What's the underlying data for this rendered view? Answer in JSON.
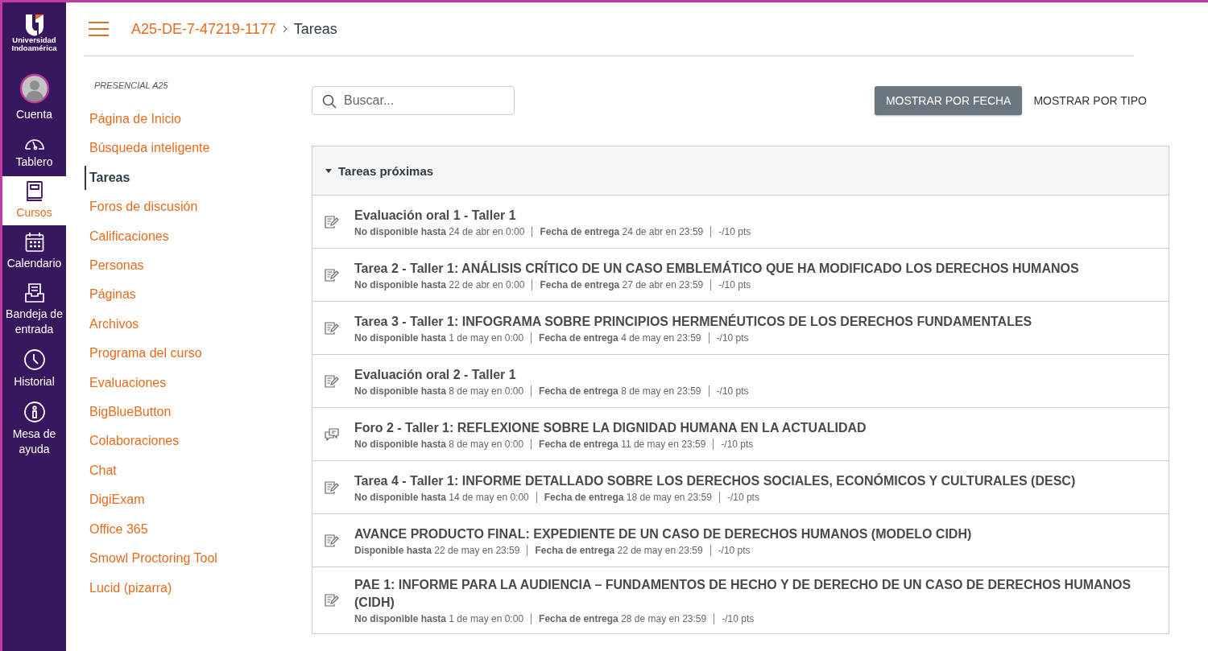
{
  "global_nav": {
    "logo_lines": [
      "Universidad",
      "Indoamérica"
    ],
    "items": [
      {
        "kind": "account",
        "label": "Cuenta",
        "selected": false
      },
      {
        "kind": "dashboard",
        "label": "Tablero",
        "selected": false
      },
      {
        "kind": "courses",
        "label": "Cursos",
        "selected": true
      },
      {
        "kind": "calendar",
        "label": "Calendario",
        "selected": false
      },
      {
        "kind": "inbox",
        "label": "Bandeja de entrada",
        "selected": false
      },
      {
        "kind": "history",
        "label": "Historial",
        "selected": false
      },
      {
        "kind": "help",
        "label": "Mesa de ayuda",
        "selected": false
      }
    ]
  },
  "breadcrumb": {
    "course": "A25-DE-7-47219-1177",
    "page": "Tareas"
  },
  "course_nav": {
    "section": "PRESENCIAL A25",
    "items": [
      {
        "label": "Página de Inicio",
        "selected": false
      },
      {
        "label": "Búsqueda inteligente",
        "selected": false
      },
      {
        "label": "Tareas",
        "selected": true
      },
      {
        "label": "Foros de discusión",
        "selected": false
      },
      {
        "label": "Calificaciones",
        "selected": false
      },
      {
        "label": "Personas",
        "selected": false
      },
      {
        "label": "Páginas",
        "selected": false
      },
      {
        "label": "Archivos",
        "selected": false
      },
      {
        "label": "Programa del curso",
        "selected": false
      },
      {
        "label": "Evaluaciones",
        "selected": false
      },
      {
        "label": "BigBlueButton",
        "selected": false
      },
      {
        "label": "Colaboraciones",
        "selected": false
      },
      {
        "label": "Chat",
        "selected": false
      },
      {
        "label": "DigiExam",
        "selected": false
      },
      {
        "label": "Office 365",
        "selected": false
      },
      {
        "label": "Smowl Proctoring Tool",
        "selected": false
      },
      {
        "label": "Lucid (pizarra)",
        "selected": false
      }
    ]
  },
  "search": {
    "placeholder": "Buscar..."
  },
  "view_buttons": [
    {
      "label": "MOSTRAR POR FECHA",
      "selected": true
    },
    {
      "label": "MOSTRAR POR TIPO",
      "selected": false
    }
  ],
  "group": {
    "title": "Tareas próximas",
    "expanded": true,
    "assignments": [
      {
        "kind": "assignment",
        "title": "Evaluación oral 1 - Taller 1",
        "availability": "**No disponible hasta** 24 de abr en 0:00",
        "due": "**Fecha de entrega** 24 de abr en 23:59",
        "points": "-/10 pts"
      },
      {
        "kind": "assignment",
        "title": "Tarea 2 - Taller 1: ANÁLISIS CRÍTICO DE UN CASO EMBLEMÁTICO QUE HA MODIFICADO LOS DERECHOS HUMANOS",
        "availability": "**No disponible hasta** 22 de abr en 0:00",
        "due": "**Fecha de entrega** 27 de abr en 23:59",
        "points": "-/10 pts"
      },
      {
        "kind": "assignment",
        "title": "Tarea 3 - Taller 1: INFOGRAMA SOBRE PRINCIPIOS HERMENÉUTICOS DE LOS DERECHOS FUNDAMENTALES",
        "availability": "**No disponible hasta** 1 de may en 0:00",
        "due": "**Fecha de entrega** 4 de may en 23:59",
        "points": "-/10 pts"
      },
      {
        "kind": "assignment",
        "title": "Evaluación oral 2 - Taller 1",
        "availability": "**No disponible hasta** 8 de may en 0:00",
        "due": "**Fecha de entrega** 8 de may en 23:59",
        "points": "-/10 pts"
      },
      {
        "kind": "discussion",
        "title": "Foro 2 - Taller 1: REFLEXIONE SOBRE LA DIGNIDAD HUMANA EN LA ACTUALIDAD",
        "availability": "**No disponible hasta** 8 de may en 0:00",
        "due": "**Fecha de entrega** 11 de may en 23:59",
        "points": "-/10 pts"
      },
      {
        "kind": "assignment",
        "title": "Tarea 4 - Taller 1: INFORME DETALLADO SOBRE LOS DERECHOS SOCIALES, ECONÓMICOS Y CULTURALES (DESC)",
        "availability": "**No disponible hasta** 14 de may en 0:00",
        "due": "**Fecha de entrega** 18 de may en 23:59",
        "points": "-/10 pts"
      },
      {
        "kind": "assignment",
        "title": "AVANCE PRODUCTO FINAL: EXPEDIENTE DE UN CASO DE DERECHOS HUMANOS (MODELO CIDH)",
        "availability": "**Disponible hasta** 22 de may en 23:59",
        "due": "**Fecha de entrega** 22 de may en 23:59",
        "points": "-/10 pts"
      },
      {
        "kind": "assignment",
        "title": "PAE 1: INFORME PARA LA AUDIENCIA – FUNDAMENTOS DE HECHO Y DE DERECHO DE UN CASO DE DERECHOS HUMANOS (CIDH)",
        "availability": "**No disponible hasta** 1 de may en 0:00",
        "due": "**Fecha de entrega** 28 de may en 23:59",
        "points": "-/10 pts"
      }
    ]
  }
}
